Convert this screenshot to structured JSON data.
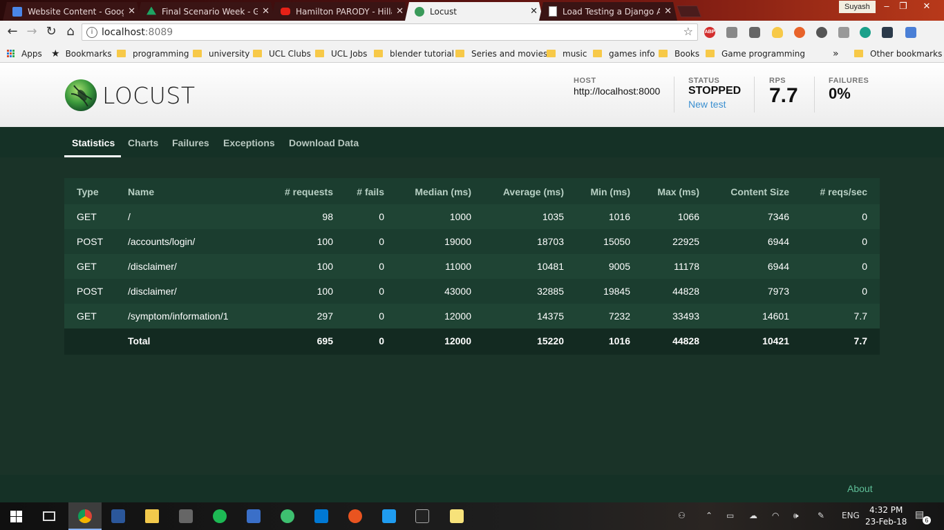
{
  "browser": {
    "tabs": [
      {
        "title": "Website Content - Goog",
        "fav_color": "#4a86e8"
      },
      {
        "title": "Final Scenario Week - Go",
        "fav_color": "#1fa463"
      },
      {
        "title": "Hamilton PARODY - Hilla",
        "fav_color": "#e62117"
      },
      {
        "title": "Locust",
        "fav_color": "#3a9a5a"
      },
      {
        "title": "Load Testing a Django Ap",
        "fav_color": "#ffffff"
      }
    ],
    "profile": "Suyash",
    "url_host": "localhost",
    "url_port": ":8089",
    "extension_badge": "ABP",
    "bookmarks": [
      {
        "label": "Apps"
      },
      {
        "label": "Bookmarks"
      },
      {
        "label": "programming"
      },
      {
        "label": "university"
      },
      {
        "label": "UCL Clubs"
      },
      {
        "label": "UCL Jobs"
      },
      {
        "label": "blender tutorial"
      },
      {
        "label": "Series and movies"
      },
      {
        "label": "music"
      },
      {
        "label": "games info"
      },
      {
        "label": "Books"
      },
      {
        "label": "Game programming"
      }
    ],
    "overflow": "»",
    "other_bookmarks": "Other bookmarks"
  },
  "locust": {
    "logo_text": "LOCUST",
    "host_label": "HOST",
    "host_value": "http://localhost:8000",
    "status_label": "STATUS",
    "status_value": "STOPPED",
    "new_test": "New test",
    "rps_label": "RPS",
    "rps_value": "7.7",
    "failures_label": "FAILURES",
    "failures_value": "0%",
    "nav": [
      "Statistics",
      "Charts",
      "Failures",
      "Exceptions",
      "Download Data"
    ],
    "table": {
      "columns": [
        "Type",
        "Name",
        "# requests",
        "# fails",
        "Median (ms)",
        "Average (ms)",
        "Min (ms)",
        "Max (ms)",
        "Content Size",
        "# reqs/sec"
      ],
      "rows": [
        [
          "GET",
          "/",
          "98",
          "0",
          "1000",
          "1035",
          "1016",
          "1066",
          "7346",
          "0"
        ],
        [
          "POST",
          "/accounts/login/",
          "100",
          "0",
          "19000",
          "18703",
          "15050",
          "22925",
          "6944",
          "0"
        ],
        [
          "GET",
          "/disclaimer/",
          "100",
          "0",
          "11000",
          "10481",
          "9005",
          "11178",
          "6944",
          "0"
        ],
        [
          "POST",
          "/disclaimer/",
          "100",
          "0",
          "43000",
          "32885",
          "19845",
          "44828",
          "7973",
          "0"
        ],
        [
          "GET",
          "/symptom/information/1",
          "297",
          "0",
          "12000",
          "14375",
          "7232",
          "33493",
          "14601",
          "7.7"
        ]
      ],
      "total": [
        "",
        "Total",
        "695",
        "0",
        "12000",
        "15220",
        "1016",
        "44828",
        "10421",
        "7.7"
      ]
    },
    "about": "About"
  },
  "taskbar": {
    "lang": "ENG",
    "time": "4:32 PM",
    "date": "23-Feb-18",
    "notification_count": "6"
  }
}
